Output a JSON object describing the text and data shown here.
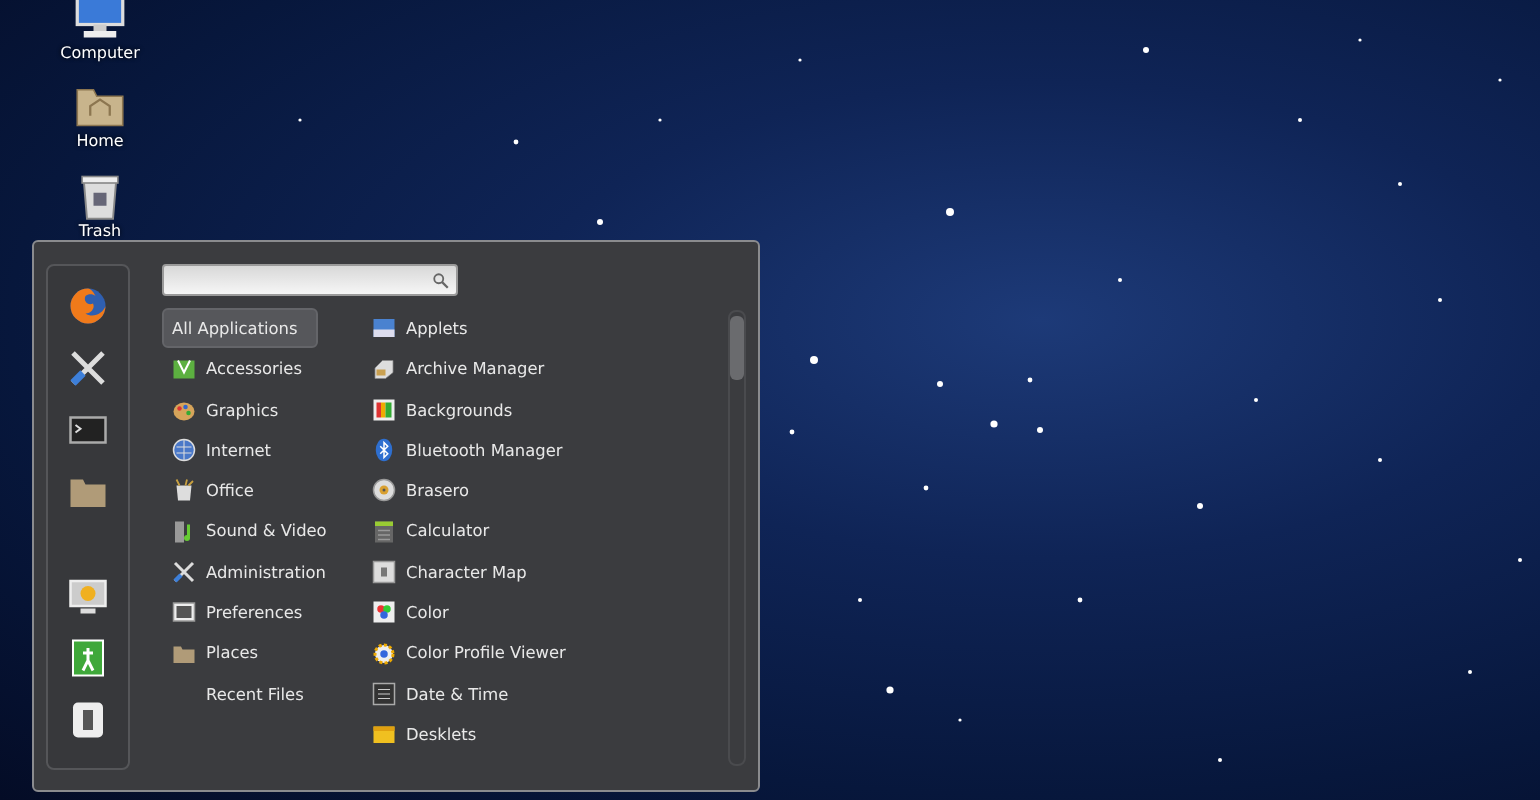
{
  "desktop_icons": [
    {
      "label": "Computer"
    },
    {
      "label": "Home"
    },
    {
      "label": "Trash"
    }
  ],
  "menu": {
    "categories": [
      {
        "label": "All Applications",
        "selected": true
      },
      {
        "label": "Accessories",
        "selected": false
      },
      {
        "label": "Graphics",
        "selected": false
      },
      {
        "label": "Internet",
        "selected": false
      },
      {
        "label": "Office",
        "selected": false
      },
      {
        "label": "Sound & Video",
        "selected": false
      },
      {
        "label": "Administration",
        "selected": false
      },
      {
        "label": "Preferences",
        "selected": false
      },
      {
        "label": "Places",
        "selected": false
      },
      {
        "label": "Recent Files",
        "selected": false
      }
    ],
    "applications": [
      {
        "label": "Applets"
      },
      {
        "label": "Archive Manager"
      },
      {
        "label": "Backgrounds"
      },
      {
        "label": "Bluetooth Manager"
      },
      {
        "label": "Brasero"
      },
      {
        "label": "Calculator"
      },
      {
        "label": "Character Map"
      },
      {
        "label": "Color"
      },
      {
        "label": "Color Profile Viewer"
      },
      {
        "label": "Date & Time"
      },
      {
        "label": "Desklets"
      }
    ]
  }
}
